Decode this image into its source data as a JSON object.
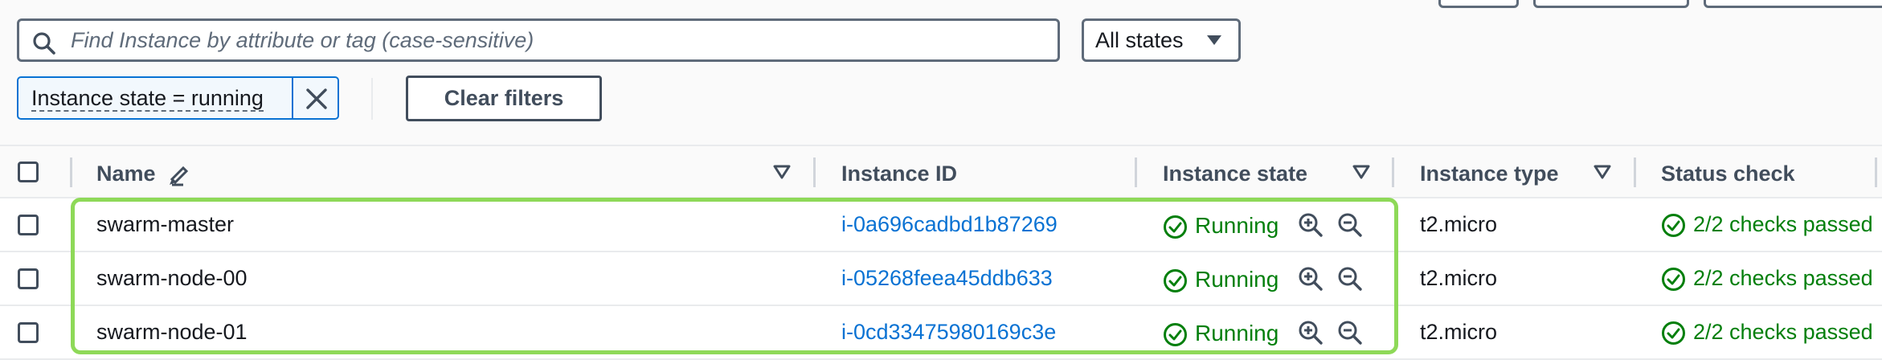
{
  "toolbar": {
    "search_placeholder": "Find Instance by attribute or tag (case-sensitive)",
    "state_filter": "All states",
    "active_token": "Instance state = running",
    "clear_filters_label": "Clear filters"
  },
  "table": {
    "columns": [
      "Name",
      "Instance ID",
      "Instance state",
      "Instance type",
      "Status check"
    ],
    "rows": [
      {
        "name": "swarm-master",
        "instance_id": "i-0a696cadbd1b87269",
        "state": "Running",
        "type": "t2.micro",
        "status": "2/2 checks passed"
      },
      {
        "name": "swarm-node-00",
        "instance_id": "i-05268feea45ddb633",
        "state": "Running",
        "type": "t2.micro",
        "status": "2/2 checks passed"
      },
      {
        "name": "swarm-node-01",
        "instance_id": "i-0cd33475980169c3e",
        "state": "Running",
        "type": "t2.micro",
        "status": "2/2 checks passed"
      }
    ]
  },
  "icons": {
    "search": "search-icon",
    "dropdown": "caret-down-icon",
    "remove_token": "close-icon",
    "edit": "pencil-icon",
    "sort": "sort-caret-icon",
    "running": "check-circle-icon",
    "zoom_in": "zoom-in-icon",
    "zoom_out": "zoom-out-icon",
    "status_ok": "check-circle-icon"
  },
  "colors": {
    "link": "#0972d3",
    "success": "#037f0c",
    "highlight": "#8ed958",
    "border": "#5f6b7a"
  }
}
